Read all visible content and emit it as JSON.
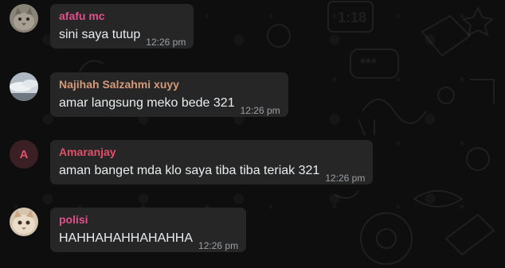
{
  "messages": [
    {
      "sender": "afafu mc",
      "text": "sini saya tutup",
      "time": "12:26 pm",
      "sender_color": "#e0508c",
      "avatar": "cat-photo"
    },
    {
      "sender": "Najihah Salzahmi xuyy",
      "text": "amar langsung meko bede 321",
      "time": "12:26 pm",
      "sender_color": "#d49a7a",
      "avatar": "sky-photo"
    },
    {
      "sender": "Amaranjay",
      "text": "aman banget mda klo saya tiba tiba teriak 321",
      "time": "12:26 pm",
      "sender_color": "#e0506a",
      "avatar_letter": "A"
    },
    {
      "sender": "polisi",
      "text": "HAHHAHAHHAHAHHA",
      "time": "12:26 pm",
      "sender_color": "#e0508c",
      "avatar": "cat-photo"
    }
  ],
  "colors": {
    "background": "#0e0e0e",
    "bubble": "#262626",
    "message_text": "#e9edef",
    "timestamp": "#9aa0a4"
  },
  "background_doodles": {
    "clock_text": "1:18",
    "lock_text": "***"
  }
}
